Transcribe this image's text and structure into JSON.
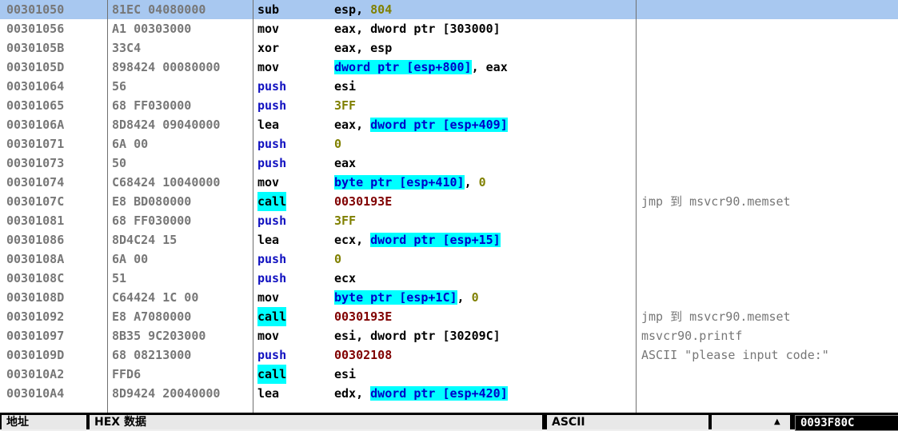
{
  "rows": [
    {
      "addr": "00301050",
      "hex": "81EC 04080000",
      "mn": "sub",
      "op": [
        {
          "t": "esp, "
        },
        {
          "t": "804",
          "c": "imm"
        }
      ],
      "cm": "",
      "selected": true
    },
    {
      "addr": "00301056",
      "hex": "A1 00303000",
      "mn": "mov",
      "op": [
        {
          "t": "eax, dword ptr [303000]"
        }
      ],
      "cm": ""
    },
    {
      "addr": "0030105B",
      "hex": "33C4",
      "mn": "xor",
      "op": [
        {
          "t": "eax, esp"
        }
      ],
      "cm": ""
    },
    {
      "addr": "0030105D",
      "hex": "898424 00080000",
      "mn": "mov",
      "op": [
        {
          "t": "dword ptr [esp+800]",
          "c": "hl"
        },
        {
          "t": ", eax"
        }
      ],
      "cm": ""
    },
    {
      "addr": "00301064",
      "hex": "56",
      "mn": "push",
      "op": [
        {
          "t": "esi"
        }
      ],
      "cm": ""
    },
    {
      "addr": "00301065",
      "hex": "68 FF030000",
      "mn": "push",
      "op": [
        {
          "t": "3FF",
          "c": "imm"
        }
      ],
      "cm": ""
    },
    {
      "addr": "0030106A",
      "hex": "8D8424 09040000",
      "mn": "lea",
      "op": [
        {
          "t": "eax, "
        },
        {
          "t": "dword ptr [esp+409]",
          "c": "hl"
        }
      ],
      "cm": ""
    },
    {
      "addr": "00301071",
      "hex": "6A 00",
      "mn": "push",
      "op": [
        {
          "t": "0",
          "c": "imm"
        }
      ],
      "cm": ""
    },
    {
      "addr": "00301073",
      "hex": "50",
      "mn": "push",
      "op": [
        {
          "t": "eax"
        }
      ],
      "cm": ""
    },
    {
      "addr": "00301074",
      "hex": "C68424 10040000",
      "mn": "mov",
      "op": [
        {
          "t": "byte ptr [esp+410]",
          "c": "hl"
        },
        {
          "t": ", "
        },
        {
          "t": "0",
          "c": "imm"
        }
      ],
      "cm": ""
    },
    {
      "addr": "0030107C",
      "hex": "E8 BD080000",
      "mn": "call",
      "op": [
        {
          "t": "0030193E",
          "c": "addrc"
        }
      ],
      "cm": "jmp 到 msvcr90.memset"
    },
    {
      "addr": "00301081",
      "hex": "68 FF030000",
      "mn": "push",
      "op": [
        {
          "t": "3FF",
          "c": "imm"
        }
      ],
      "cm": ""
    },
    {
      "addr": "00301086",
      "hex": "8D4C24 15",
      "mn": "lea",
      "op": [
        {
          "t": "ecx, "
        },
        {
          "t": "dword ptr [esp+15]",
          "c": "hl"
        }
      ],
      "cm": ""
    },
    {
      "addr": "0030108A",
      "hex": "6A 00",
      "mn": "push",
      "op": [
        {
          "t": "0",
          "c": "imm"
        }
      ],
      "cm": ""
    },
    {
      "addr": "0030108C",
      "hex": "51",
      "mn": "push",
      "op": [
        {
          "t": "ecx"
        }
      ],
      "cm": ""
    },
    {
      "addr": "0030108D",
      "hex": "C64424 1C 00",
      "mn": "mov",
      "op": [
        {
          "t": "byte ptr [esp+1C]",
          "c": "hl"
        },
        {
          "t": ", "
        },
        {
          "t": "0",
          "c": "imm"
        }
      ],
      "cm": ""
    },
    {
      "addr": "00301092",
      "hex": "E8 A7080000",
      "mn": "call",
      "op": [
        {
          "t": "0030193E",
          "c": "addrc"
        }
      ],
      "cm": "jmp 到 msvcr90.memset"
    },
    {
      "addr": "00301097",
      "hex": "8B35 9C203000",
      "mn": "mov",
      "op": [
        {
          "t": "esi, dword ptr [30209C]"
        }
      ],
      "cm": "msvcr90.printf"
    },
    {
      "addr": "0030109D",
      "hex": "68 08213000",
      "mn": "push",
      "op": [
        {
          "t": "00302108",
          "c": "addrc"
        }
      ],
      "cm": "ASCII \"please input code:\""
    },
    {
      "addr": "003010A2",
      "hex": "FFD6",
      "mn": "call",
      "op": [
        {
          "t": "esi"
        }
      ],
      "cm": ""
    },
    {
      "addr": "003010A4",
      "hex": "8D9424 20040000",
      "mn": "lea",
      "op": [
        {
          "t": "edx, "
        },
        {
          "t": "dword ptr [esp+420]",
          "c": "hl"
        }
      ],
      "cm": ""
    }
  ],
  "dump_header": {
    "address": "地址",
    "hex": "HEX 数据",
    "ascii": "ASCII",
    "value": "0093F80C"
  }
}
